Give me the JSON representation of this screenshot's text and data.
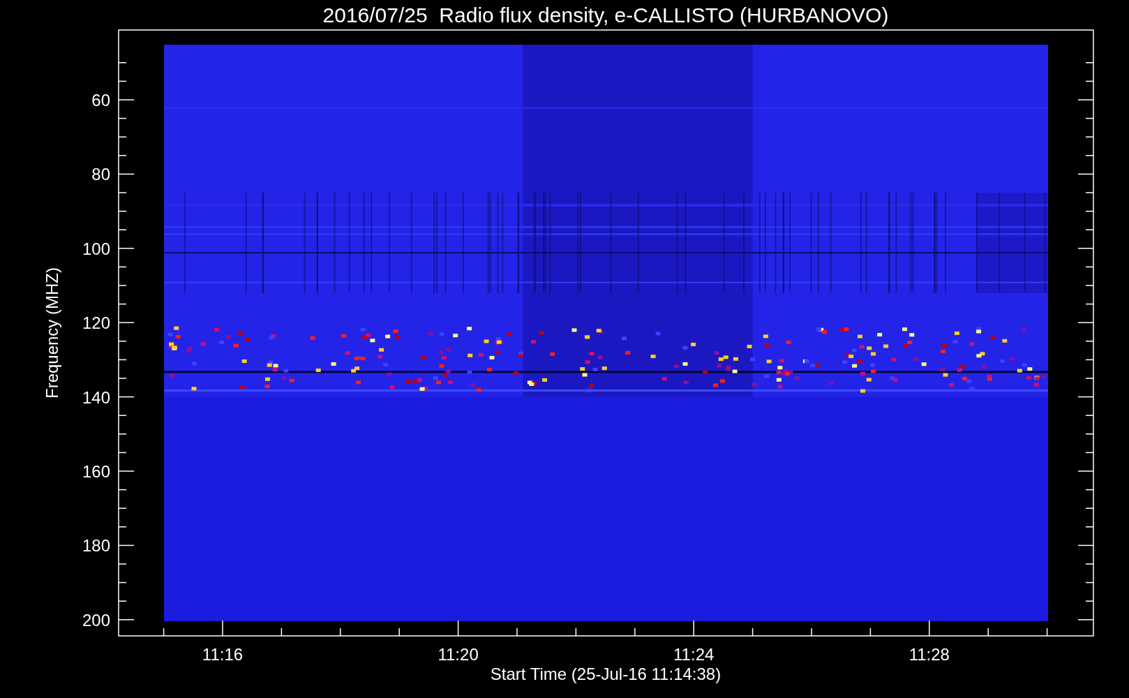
{
  "title": "2016/07/25  Radio flux density, e-CALLISTO (HURBANOVO)",
  "y_axis": {
    "label": "Frequency (MHZ)",
    "ticks": [
      "60",
      "80",
      "100",
      "120",
      "140",
      "160",
      "180",
      "200"
    ]
  },
  "x_axis": {
    "label": "Start Time (25-Jul-16 11:14:38)",
    "ticks": [
      "11:16",
      "11:20",
      "11:24",
      "11:28"
    ]
  }
}
